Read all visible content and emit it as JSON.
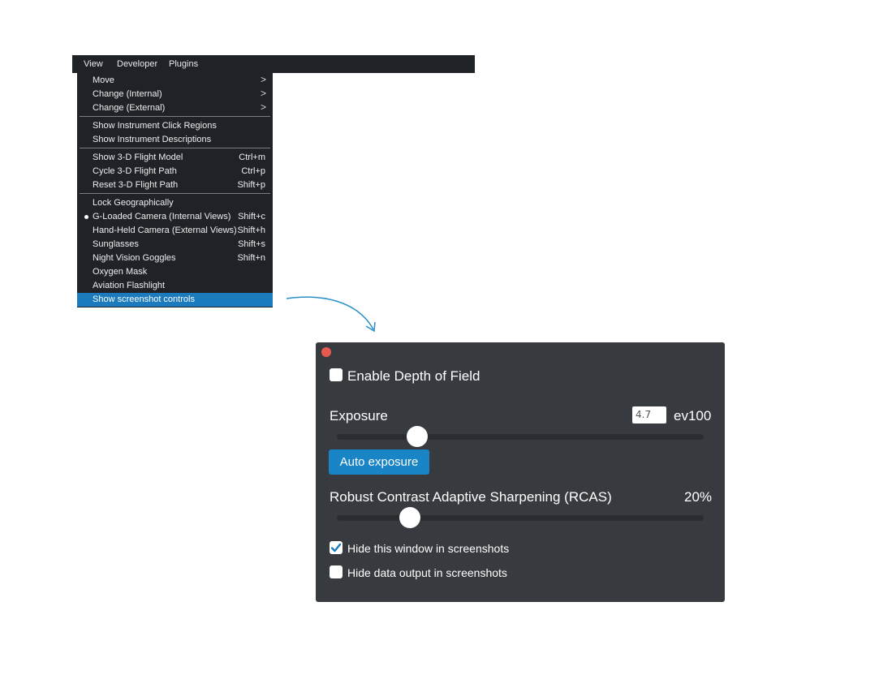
{
  "menubar": {
    "items": [
      {
        "label": "View"
      },
      {
        "label": "Developer"
      },
      {
        "label": "Plugins"
      }
    ]
  },
  "menu": {
    "items": [
      {
        "label": "Move"
      },
      {
        "label": "Change (Internal)"
      },
      {
        "label": "Change (External)"
      },
      {
        "label": "Show Instrument Click Regions"
      },
      {
        "label": "Show Instrument Descriptions"
      },
      {
        "label": "Show 3-D Flight Model",
        "shortcut": "Ctrl+m"
      },
      {
        "label": "Cycle 3-D Flight Path",
        "shortcut": "Ctrl+p"
      },
      {
        "label": "Reset 3-D Flight Path",
        "shortcut": "Shift+p"
      },
      {
        "label": "Lock Geographically"
      },
      {
        "label": "G-Loaded Camera (Internal Views)",
        "shortcut": "Shift+c"
      },
      {
        "label": "Hand-Held Camera (External Views)",
        "shortcut": "Shift+h"
      },
      {
        "label": "Sunglasses",
        "shortcut": "Shift+s"
      },
      {
        "label": "Night Vision Goggles",
        "shortcut": "Shift+n"
      },
      {
        "label": "Oxygen Mask"
      },
      {
        "label": "Aviation Flashlight"
      },
      {
        "label": "Show screenshot controls"
      }
    ]
  },
  "panel": {
    "depth_of_field": {
      "label": "Enable Depth of Field",
      "checked": false
    },
    "exposure": {
      "label": "Exposure",
      "value": "4.7",
      "unit": "ev100",
      "slider_fraction": 0.22
    },
    "auto_exposure_label": "Auto exposure",
    "rcas": {
      "label": "Robust Contrast Adaptive Sharpening (RCAS)",
      "value_text": "20%",
      "slider_fraction": 0.2
    },
    "hide_window": {
      "label": "Hide this window in screenshots",
      "checked": true
    },
    "hide_data": {
      "label": "Hide data output in screenshots",
      "checked": false
    }
  },
  "colors": {
    "menu_bg": "#1f2227",
    "menu_highlight": "#1b7bbd",
    "panel_bg": "#373a3f",
    "button_bg": "#1984c6",
    "close_dot": "#e85a50",
    "arrow": "#2a8fc9"
  }
}
